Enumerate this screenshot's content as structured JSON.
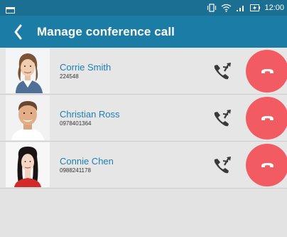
{
  "status_bar": {
    "time": "12:00",
    "icons": [
      "notification-icon",
      "vibrate-icon",
      "wifi-icon",
      "signal-icon",
      "battery-charging-icon"
    ]
  },
  "header": {
    "title": "Manage conference call",
    "back_icon": "back-chevron-icon"
  },
  "participants": [
    {
      "name": "Corrie Smith",
      "number": "224548"
    },
    {
      "name": "Christian Ross",
      "number": "0978401364"
    },
    {
      "name": "Connie Chen",
      "number": "0988241178"
    }
  ],
  "colors": {
    "status_bar": "#1b6f92",
    "title_bar": "#1b7da6",
    "name_text": "#1d7fb3",
    "hangup": "#f25b61",
    "background": "#e3e3e3"
  }
}
